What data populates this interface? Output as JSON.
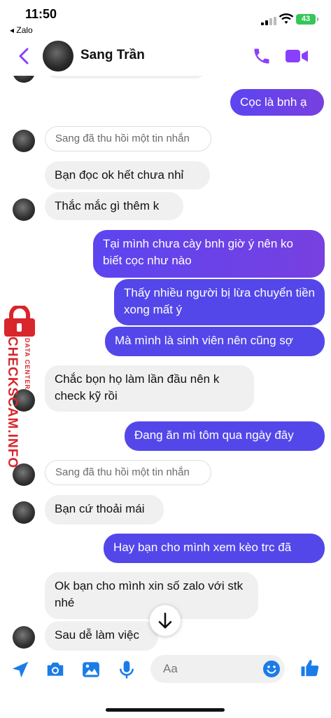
{
  "status_bar": {
    "time": "11:50",
    "back_app": "◂ Zalo",
    "battery": "43"
  },
  "header": {
    "contact_name": "Sang Trần"
  },
  "messages": {
    "m1": "Cọc là bnh ạ",
    "n1": "Sang đã thu hồi một tin nhắn",
    "m2": "Bạn đọc ok hết chưa nhỉ",
    "m3": "Thắc mắc gì thêm k",
    "m4": "Tại mình chưa cày bnh giờ ý nên ko biết cọc như nào",
    "m5": "Thấy nhiều người bị lừa chuyển tiền xong mất ý",
    "m6": "Mà mình là sinh viên nên cũng sợ",
    "m7": "Chắc bọn họ làm lần đầu nên k check kỹ rồi",
    "m8": "Đang ăn mì tôm qua ngày đây",
    "n2": "Sang đã thu hồi một tin nhắn",
    "m9": "Bạn cứ thoải mái",
    "m10": "Hay bạn cho mình xem kèo trc đã",
    "m11": "Ok bạn cho mình xin số zalo với stk nhé",
    "m12": "Sau dễ làm việc"
  },
  "watermark": {
    "title": "CHECKSCAM.INFO",
    "subtitle": "DATA CENTER"
  },
  "composer": {
    "placeholder": "Aa"
  },
  "colors": {
    "accent": "#8a3ffc",
    "outgoing": "#5b45ee",
    "incoming": "#f0f0f0",
    "watermark": "#d8262c"
  },
  "icons": [
    "back-chevron-icon",
    "phone-icon",
    "video-icon",
    "send-location-icon",
    "camera-icon",
    "gallery-icon",
    "mic-icon",
    "emoji-icon",
    "thumbs-up-icon",
    "arrow-down-icon"
  ]
}
